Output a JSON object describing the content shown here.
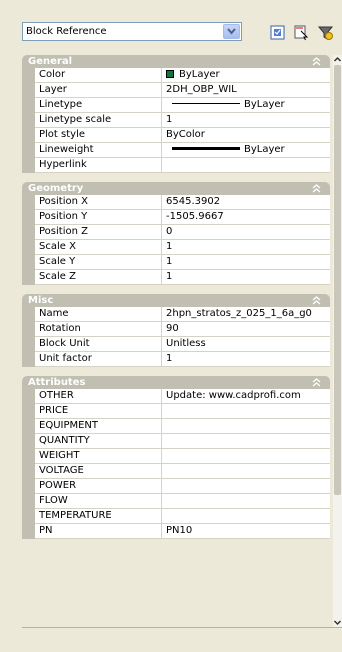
{
  "selector": {
    "selected": "Block Reference",
    "icons": [
      "quick-select-icon",
      "select-objects-icon",
      "toggle-pickadd-icon"
    ]
  },
  "sections": [
    {
      "title": "General",
      "rows": [
        {
          "label": "Color",
          "value": "ByLayer",
          "kind": "color",
          "color": "#0a7a3c"
        },
        {
          "label": "Layer",
          "value": "2DH_OBP_WIL"
        },
        {
          "label": "Linetype",
          "value": "ByLayer",
          "kind": "linetype"
        },
        {
          "label": "Linetype scale",
          "value": "1"
        },
        {
          "label": "Plot style",
          "value": "ByColor"
        },
        {
          "label": "Lineweight",
          "value": "ByLayer",
          "kind": "lineweight"
        },
        {
          "label": "Hyperlink",
          "value": ""
        }
      ]
    },
    {
      "title": "Geometry",
      "rows": [
        {
          "label": "Position X",
          "value": "6545.3902"
        },
        {
          "label": "Position Y",
          "value": "-1505.9667"
        },
        {
          "label": "Position Z",
          "value": "0"
        },
        {
          "label": "Scale X",
          "value": "1"
        },
        {
          "label": "Scale Y",
          "value": "1"
        },
        {
          "label": "Scale Z",
          "value": "1"
        }
      ]
    },
    {
      "title": "Misc",
      "rows": [
        {
          "label": "Name",
          "value": "2hpn_stratos_z_025_1_6a_g0"
        },
        {
          "label": "Rotation",
          "value": "90"
        },
        {
          "label": "Block Unit",
          "value": "Unitless"
        },
        {
          "label": "Unit factor",
          "value": "1"
        }
      ]
    },
    {
      "title": "Attributes",
      "rows": [
        {
          "label": "OTHER",
          "value": "Update: www.cadprofi.com"
        },
        {
          "label": "PRICE",
          "value": ""
        },
        {
          "label": "EQUIPMENT",
          "value": ""
        },
        {
          "label": "QUANTITY",
          "value": ""
        },
        {
          "label": "WEIGHT",
          "value": ""
        },
        {
          "label": "VOLTAGE",
          "value": ""
        },
        {
          "label": "POWER",
          "value": ""
        },
        {
          "label": "FLOW",
          "value": ""
        },
        {
          "label": "TEMPERATURE",
          "value": ""
        },
        {
          "label": "PN",
          "value": "PN10"
        }
      ]
    }
  ]
}
